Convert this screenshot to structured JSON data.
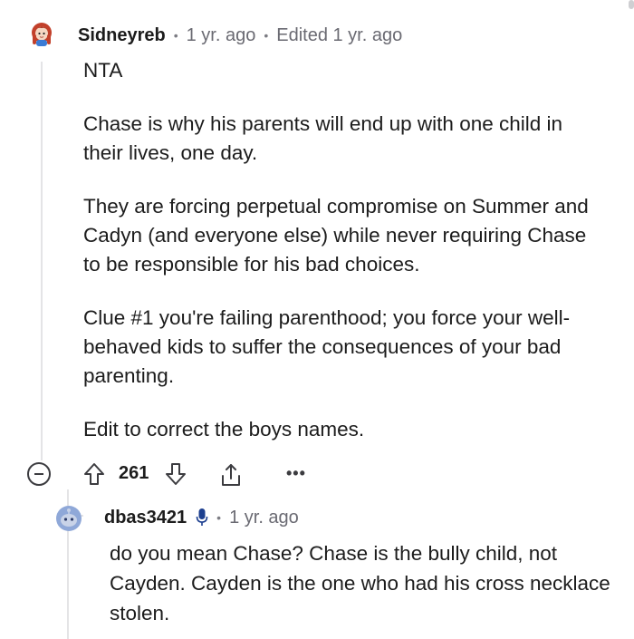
{
  "comment": {
    "username": "Sidneyreb",
    "time": "1 yr. ago",
    "edited": "Edited 1 yr. ago",
    "paragraphs": [
      "NTA",
      "Chase is why his parents will end up with one child in their lives, one day.",
      "They are forcing perpetual compromise on Summer and Cadyn (and everyone else) while never requiring Chase to be responsible for his bad choices.",
      "Clue #1 you're failing parenthood; you force your well-behaved kids to suffer the consequences of your bad parenting.",
      "Edit to correct the boys names."
    ],
    "score": "261",
    "more": "•••"
  },
  "reply": {
    "username": "dbas3421",
    "time": "1 yr. ago",
    "text": "do you mean Chase? Chase is the bully child, not Cayden. Cayden is the one who had his cross necklace stolen."
  },
  "icons": {
    "avatar_main": "redhead-avatar-icon",
    "avatar_reply": "snoo-avatar-icon",
    "collapse": "collapse-minus-icon",
    "upvote": "upvote-arrow-icon",
    "downvote": "downvote-arrow-icon",
    "share": "share-icon",
    "more": "more-dots-icon",
    "mic": "microphone-icon"
  },
  "colors": {
    "text": "#1c1c1c",
    "meta": "#6a6a72",
    "thread_line": "#e4e4e6",
    "icon": "#3c3c40"
  }
}
